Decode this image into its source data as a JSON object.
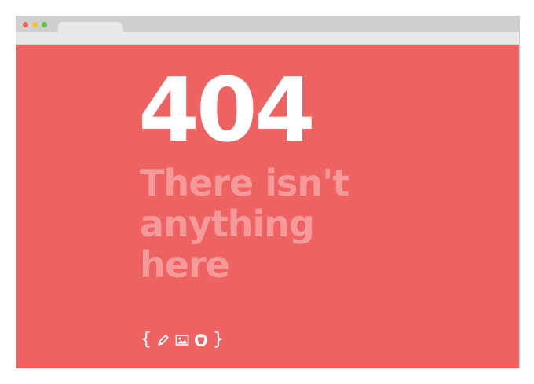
{
  "page": {
    "error_code": "404",
    "message": "There isn't anything here",
    "footer": {
      "open_brace": "{",
      "close_brace": "}",
      "icons": [
        "pencil-icon",
        "image-icon",
        "github-icon"
      ]
    }
  },
  "colors": {
    "background": "#ee6262",
    "code_text": "#ffffff",
    "message_text": "#f59a9a"
  }
}
